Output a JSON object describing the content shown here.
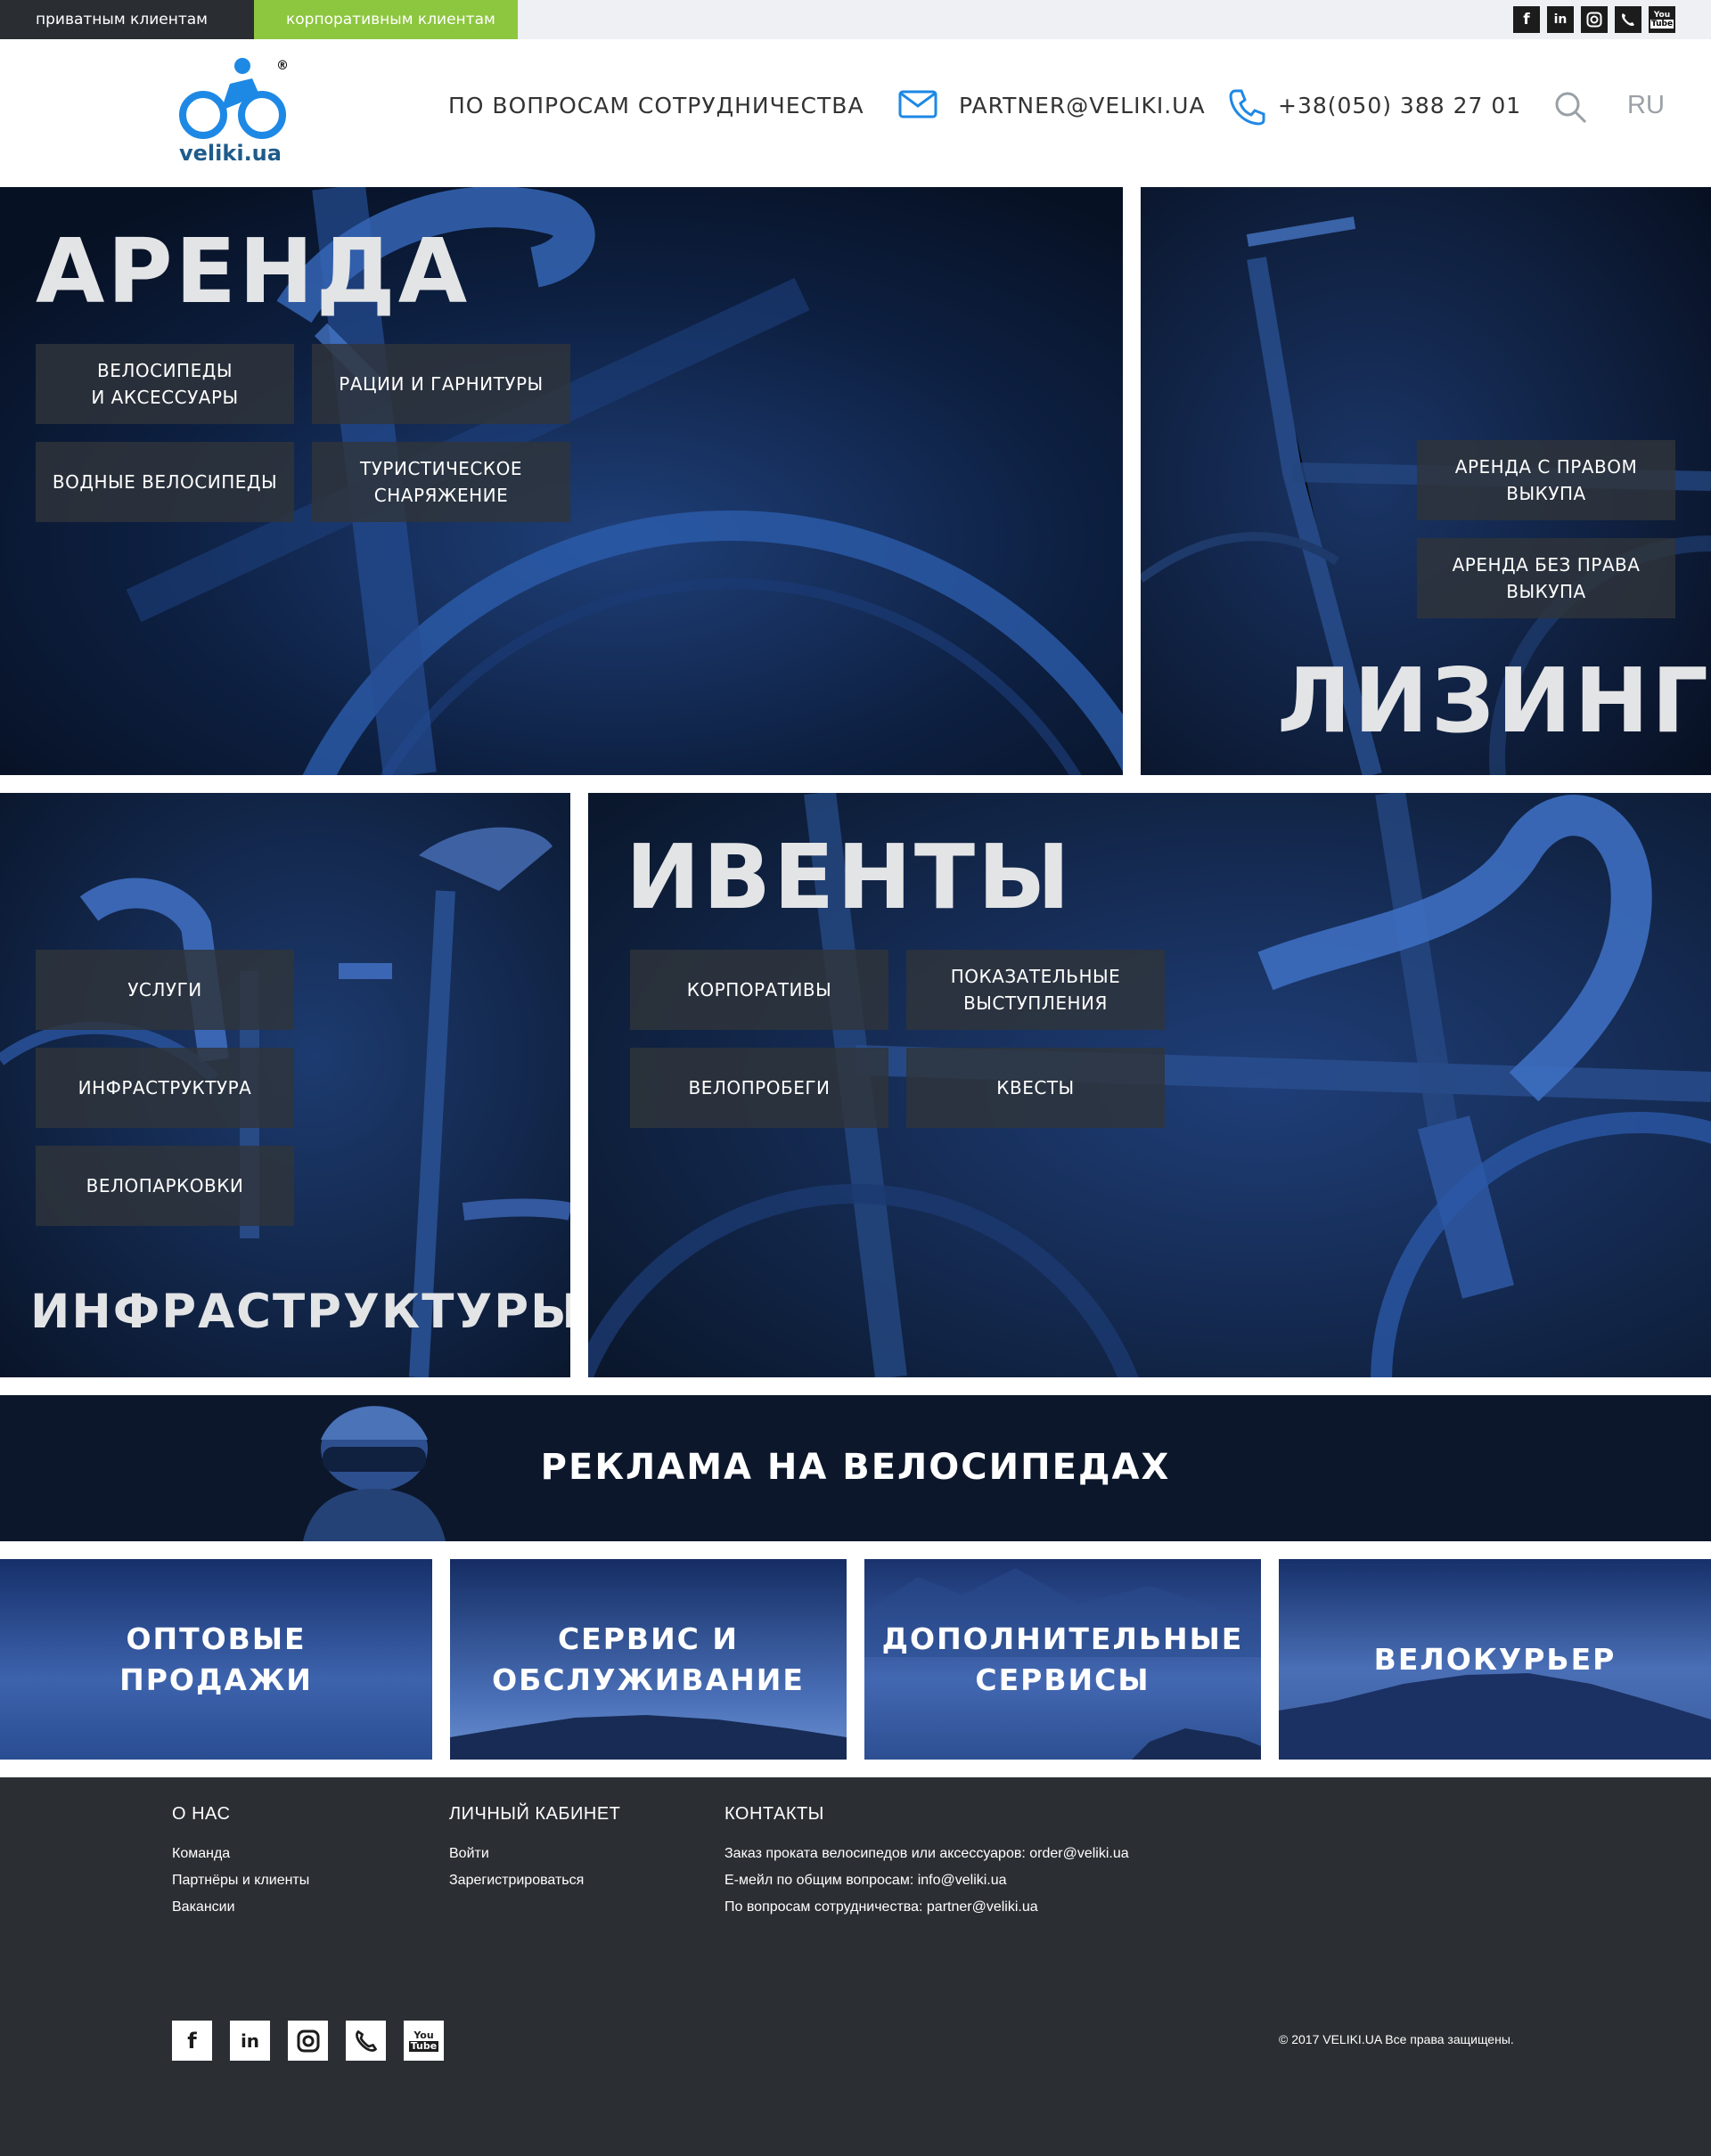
{
  "topbar": {
    "private_tab": "приватным клиентам",
    "corporate_tab": "корпоративным клиентам",
    "social": [
      "f",
      "in",
      "instagram",
      "viber",
      "youtube"
    ]
  },
  "header": {
    "logo_text": "veliki.ua",
    "cooperation": "ПО ВОПРОСАМ СОТРУДНИЧЕСТВА",
    "email": "PARTNER@VELIKI.UA",
    "phone": "+38(050) 388 27 01",
    "lang": "RU"
  },
  "arenda": {
    "title": "АРЕНДА",
    "buttons": [
      "ВЕЛОСИПЕДЫ\nИ АКСЕССУАРЫ",
      "РАЦИИ И ГАРНИТУРЫ",
      "ВОДНЫЕ ВЕЛОСИПЕДЫ",
      "ТУРИСТИЧЕСКОЕ\nСНАРЯЖЕНИЕ"
    ]
  },
  "lizing": {
    "title": "ЛИЗИНГ",
    "buttons": [
      "АРЕНДА С ПРАВОМ\nВЫКУПА",
      "АРЕНДА БЕЗ ПРАВА\nВЫКУПА"
    ]
  },
  "infra": {
    "title": "ИНФРАСТРУКТУРЫ",
    "buttons": [
      "УСЛУГИ",
      "ИНФРАСТРУКТУРА",
      "ВЕЛОПАРКОВКИ"
    ]
  },
  "events": {
    "title": "ИВЕНТЫ",
    "buttons": [
      "КОРПОРАТИВЫ",
      "ПОКАЗАТЕЛЬНЫЕ\nВЫСТУПЛЕНИЯ",
      "ВЕЛОПРОБЕГИ",
      "КВЕСТЫ"
    ]
  },
  "ads": {
    "title": "РЕКЛАМА НА ВЕЛОСИПЕДАХ"
  },
  "tiles": [
    "ОПТОВЫЕ\nПРОДАЖИ",
    "СЕРВИС И\nОБСЛУЖИВАНИЕ",
    "ДОПОЛНИТЕЛЬНЫЕ\nСЕРВИСЫ",
    "ВЕЛОКУРЬЕР"
  ],
  "footer": {
    "about": {
      "title": "О НАС",
      "links": [
        "Команда",
        "Партнёры и клиенты",
        "Вакансии"
      ]
    },
    "cabinet": {
      "title": "ЛИЧНЫЙ КАБИНЕТ",
      "links": [
        "Войти",
        "Зарегистрироваться"
      ]
    },
    "contacts": {
      "title": "КОНТАКТЫ",
      "lines": [
        "Заказ проката велосипедов или аксессуаров: order@veliki.ua",
        "E-мейл по общим вопросам: info@veliki.ua",
        "По вопросам сотрудничества: partner@veliki.ua"
      ]
    },
    "copyright": "© 2017 VELIKI.UA Все права защищены."
  },
  "colors": {
    "accent_green": "#8dc63f",
    "logo_blue": "#1e88e5",
    "footer_bg": "#2b2f33",
    "panel_blue": "#0d1a33"
  }
}
